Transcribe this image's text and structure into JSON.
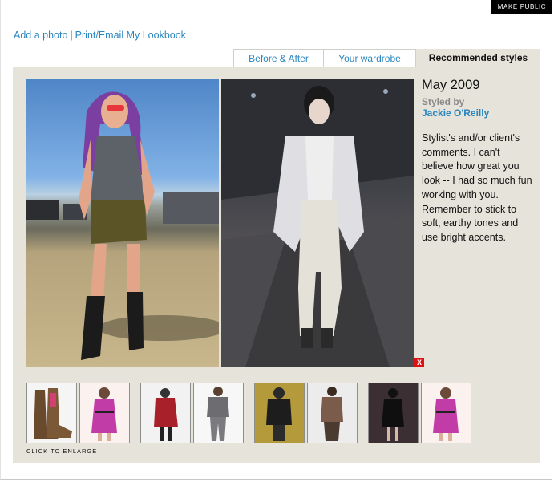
{
  "header": {
    "make_public_label": "MAKE PUBLIC",
    "add_photo_label": "Add a photo",
    "separator": "|",
    "print_email_label": "Print/Email My Lookbook"
  },
  "tabs": [
    {
      "label": "Before & After"
    },
    {
      "label": "Your wardrobe"
    },
    {
      "label": "Recommended styles",
      "active": true
    }
  ],
  "look": {
    "date": "May 2009",
    "styled_by_label": "Styled by",
    "stylist_name": "Jackie O'Reilly",
    "comment": "Stylist's and/or client's comments. I can't believe how great you look -- I had so much fun working with you. Remember to stick to soft, earthy tones and use bright accents.",
    "close_label": "X"
  },
  "thumbnails": {
    "caption": "CLICK TO ENLARGE",
    "groups": [
      [
        "boots",
        "pink-dress"
      ],
      [
        "red-dress",
        "gray-suit"
      ],
      [
        "black-jacket",
        "brown-outfit"
      ],
      [
        "black-dress",
        "pink-dress"
      ]
    ]
  },
  "colors": {
    "link": "#2a86bf",
    "panel_bg": "#e6e4da",
    "close_red": "#dd1111"
  }
}
